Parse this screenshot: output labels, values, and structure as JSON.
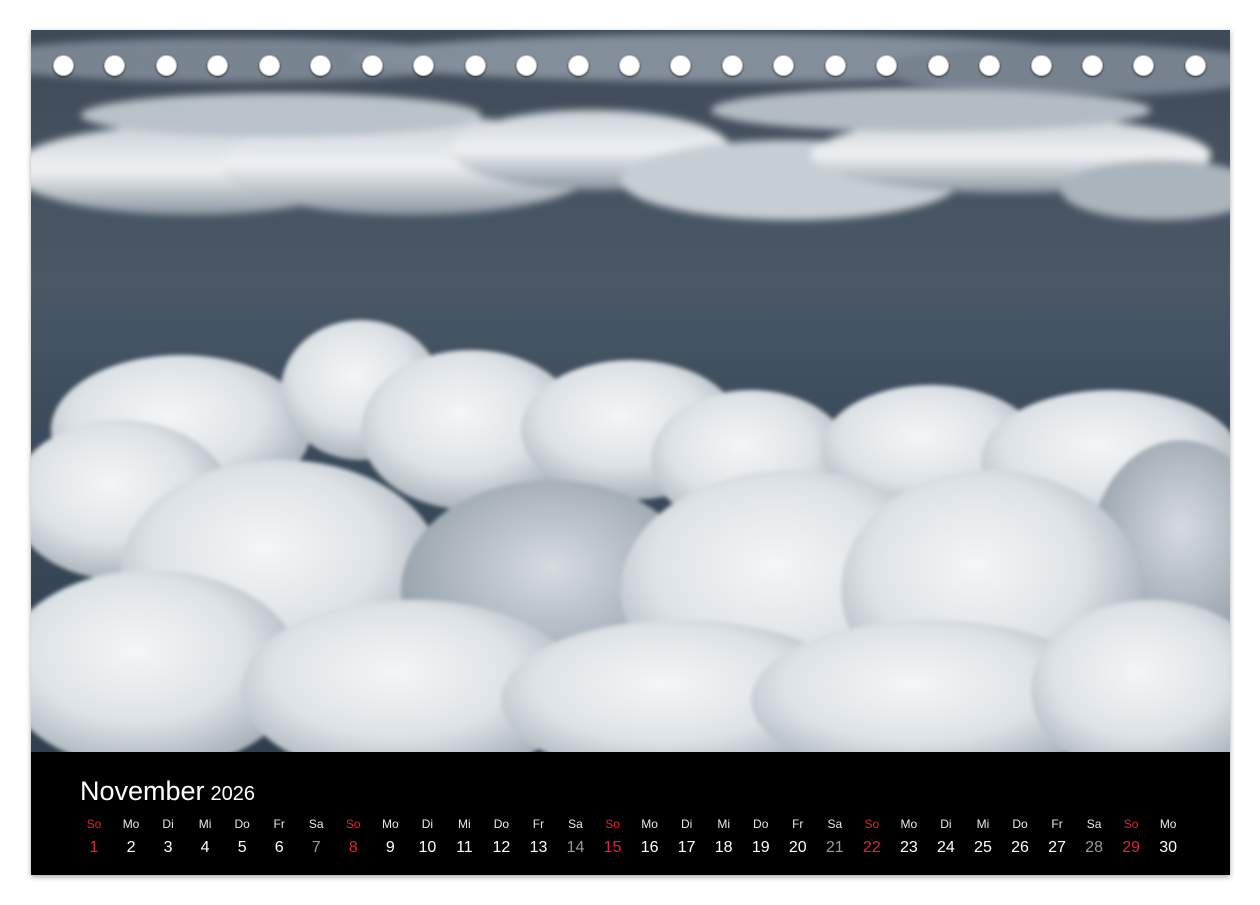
{
  "calendar": {
    "month": "November",
    "year": "2026",
    "days": [
      {
        "dow": "So",
        "num": "1",
        "type": "sun"
      },
      {
        "dow": "Mo",
        "num": "2",
        "type": "wk"
      },
      {
        "dow": "Di",
        "num": "3",
        "type": "wk"
      },
      {
        "dow": "Mi",
        "num": "4",
        "type": "wk"
      },
      {
        "dow": "Do",
        "num": "5",
        "type": "wk"
      },
      {
        "dow": "Fr",
        "num": "6",
        "type": "wk"
      },
      {
        "dow": "Sa",
        "num": "7",
        "type": "sat"
      },
      {
        "dow": "So",
        "num": "8",
        "type": "sun"
      },
      {
        "dow": "Mo",
        "num": "9",
        "type": "wk"
      },
      {
        "dow": "Di",
        "num": "10",
        "type": "wk"
      },
      {
        "dow": "Mi",
        "num": "11",
        "type": "wk"
      },
      {
        "dow": "Do",
        "num": "12",
        "type": "wk"
      },
      {
        "dow": "Fr",
        "num": "13",
        "type": "wk"
      },
      {
        "dow": "Sa",
        "num": "14",
        "type": "sat"
      },
      {
        "dow": "So",
        "num": "15",
        "type": "sun"
      },
      {
        "dow": "Mo",
        "num": "16",
        "type": "wk"
      },
      {
        "dow": "Di",
        "num": "17",
        "type": "wk"
      },
      {
        "dow": "Mi",
        "num": "18",
        "type": "wk"
      },
      {
        "dow": "Do",
        "num": "19",
        "type": "wk"
      },
      {
        "dow": "Fr",
        "num": "20",
        "type": "wk"
      },
      {
        "dow": "Sa",
        "num": "21",
        "type": "sat"
      },
      {
        "dow": "So",
        "num": "22",
        "type": "sun"
      },
      {
        "dow": "Mo",
        "num": "23",
        "type": "wk"
      },
      {
        "dow": "Di",
        "num": "24",
        "type": "wk"
      },
      {
        "dow": "Mi",
        "num": "25",
        "type": "wk"
      },
      {
        "dow": "Do",
        "num": "26",
        "type": "wk"
      },
      {
        "dow": "Fr",
        "num": "27",
        "type": "wk"
      },
      {
        "dow": "Sa",
        "num": "28",
        "type": "sat"
      },
      {
        "dow": "So",
        "num": "29",
        "type": "sun"
      },
      {
        "dow": "Mo",
        "num": "30",
        "type": "wk"
      }
    ]
  },
  "colors": {
    "sunday": "#e0262b",
    "saturday": "#9a9a9a",
    "weekday": "#ffffff",
    "band": "#000000"
  },
  "binding": {
    "hole_count": 23
  }
}
